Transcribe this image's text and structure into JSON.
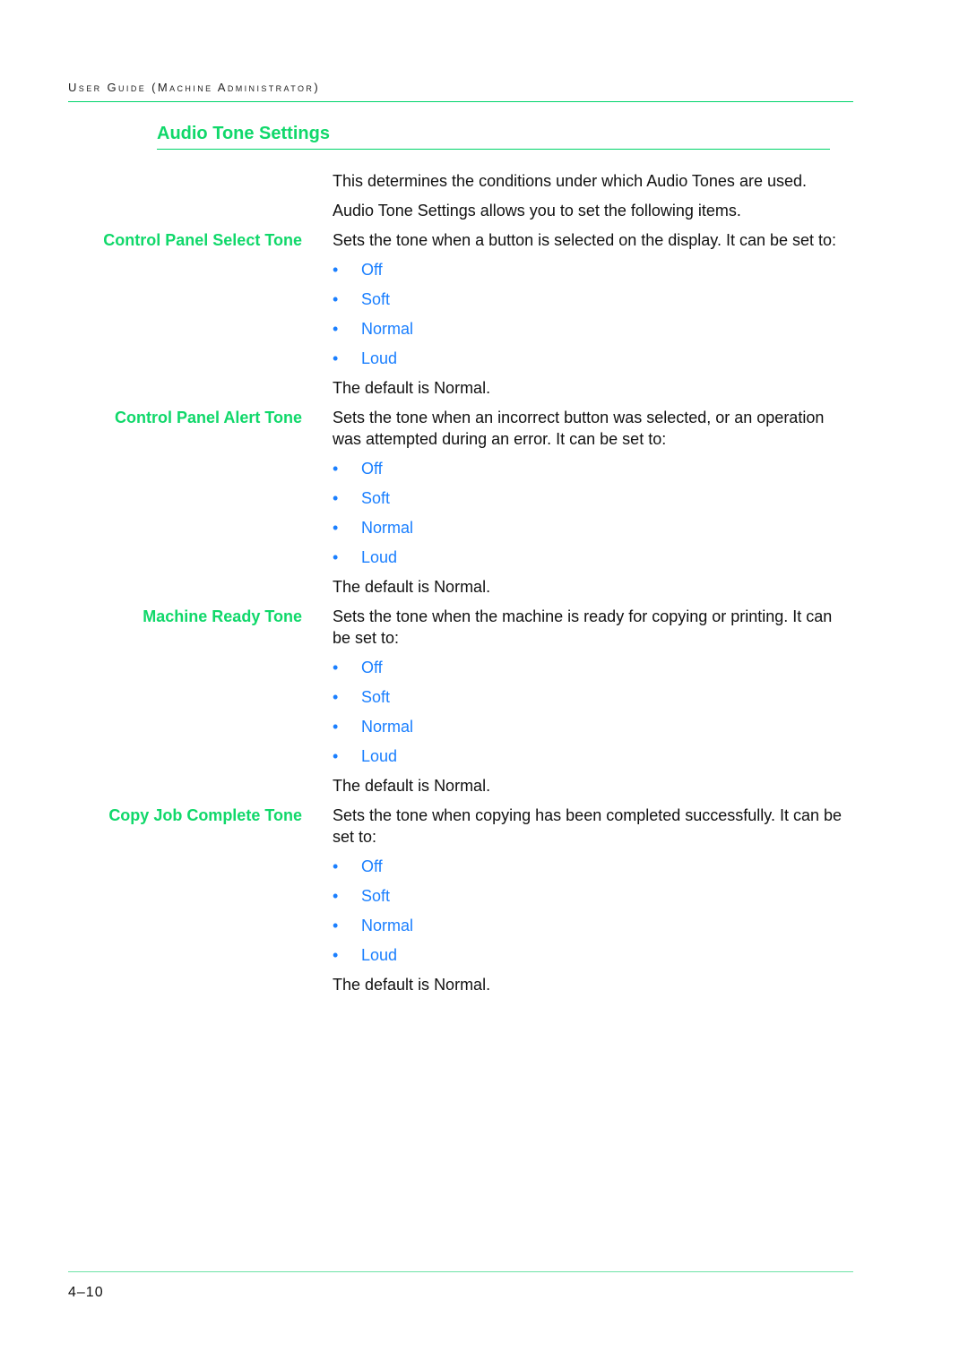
{
  "header": {
    "running_title": "User Guide (Machine Administrator)"
  },
  "section_title": "Audio Tone Settings",
  "intro": [
    "This determines the conditions under which Audio Tones are used.",
    "Audio Tone Settings allows you to set the following items."
  ],
  "sections": [
    {
      "label": "Control Panel Select Tone",
      "description": "Sets the tone when a button is selected on the display.  It can be set to:",
      "options": [
        "Off",
        "Soft",
        "Normal",
        "Loud"
      ],
      "default": "The default is Normal."
    },
    {
      "label": "Control Panel Alert Tone",
      "description": "Sets the tone when an incorrect button was selected, or an operation was attempted during an error.  It can be set to:",
      "options": [
        "Off",
        "Soft",
        "Normal",
        "Loud"
      ],
      "default": "The default is Normal."
    },
    {
      "label": "Machine Ready Tone",
      "description": "Sets the tone when the machine is ready for copying or printing.  It can be set to:",
      "options": [
        "Off",
        "Soft",
        "Normal",
        "Loud"
      ],
      "default": "The default is Normal."
    },
    {
      "label": "Copy Job Complete Tone",
      "description": "Sets the tone when copying has been completed successfully.  It can be set to:",
      "options": [
        "Off",
        "Soft",
        "Normal",
        "Loud"
      ],
      "default": "The default is Normal."
    }
  ],
  "bullet_glyph": "•",
  "footer": {
    "page_number": "4–10"
  },
  "colors": {
    "heading_green": "#10d86a",
    "option_blue": "#1a7fff",
    "rule_green": "#00d46a"
  }
}
